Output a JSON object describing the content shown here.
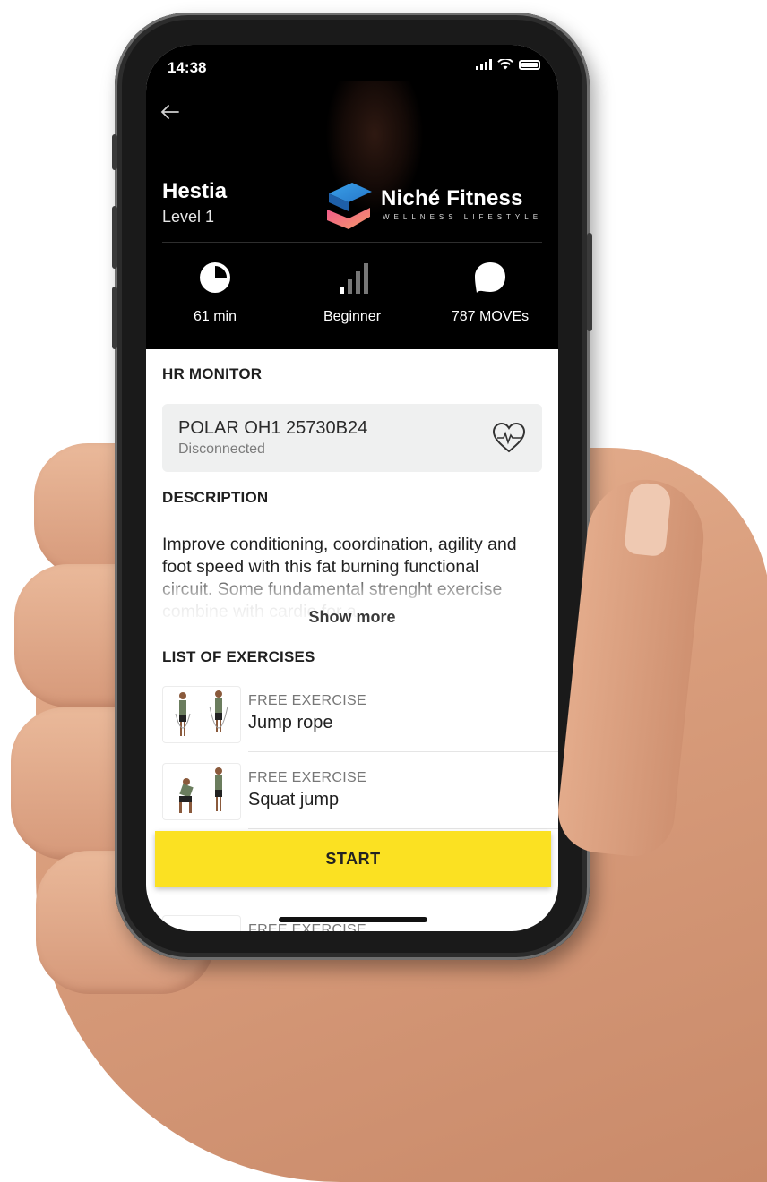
{
  "status_bar": {
    "time": "14:38"
  },
  "workout": {
    "title": "Hestia",
    "level": "Level 1"
  },
  "brand": {
    "name": "Niché Fitness",
    "tagline": "WELLNESS LIFESTYLE"
  },
  "stats": [
    {
      "icon": "clock-icon",
      "label": "61 min"
    },
    {
      "icon": "difficulty-bars-icon",
      "label": "Beginner"
    },
    {
      "icon": "moves-icon",
      "label": "787 MOVEs"
    }
  ],
  "hr_monitor": {
    "heading": "HR MONITOR",
    "device": "POLAR OH1 25730B24",
    "status": "Disconnected",
    "icon": "heart-rate-icon"
  },
  "description": {
    "heading": "DESCRIPTION",
    "text": "Improve conditioning, coordination, agility and foot speed with this fat burning functional circuit. Some fundamental strenght exercise combine with cardio for a",
    "show_more": "Show more"
  },
  "exercises": {
    "heading": "LIST OF EXERCISES",
    "items": [
      {
        "type": "FREE EXERCISE",
        "name": "Jump rope"
      },
      {
        "type": "FREE EXERCISE",
        "name": "Squat jump"
      },
      {
        "type": "FREE EXERCISE",
        "name": ""
      }
    ]
  },
  "actions": {
    "start_label": "START"
  },
  "colors": {
    "accent": "#FBE122",
    "hero_bg": "#000000",
    "card_bg": "#EFF0F0"
  }
}
